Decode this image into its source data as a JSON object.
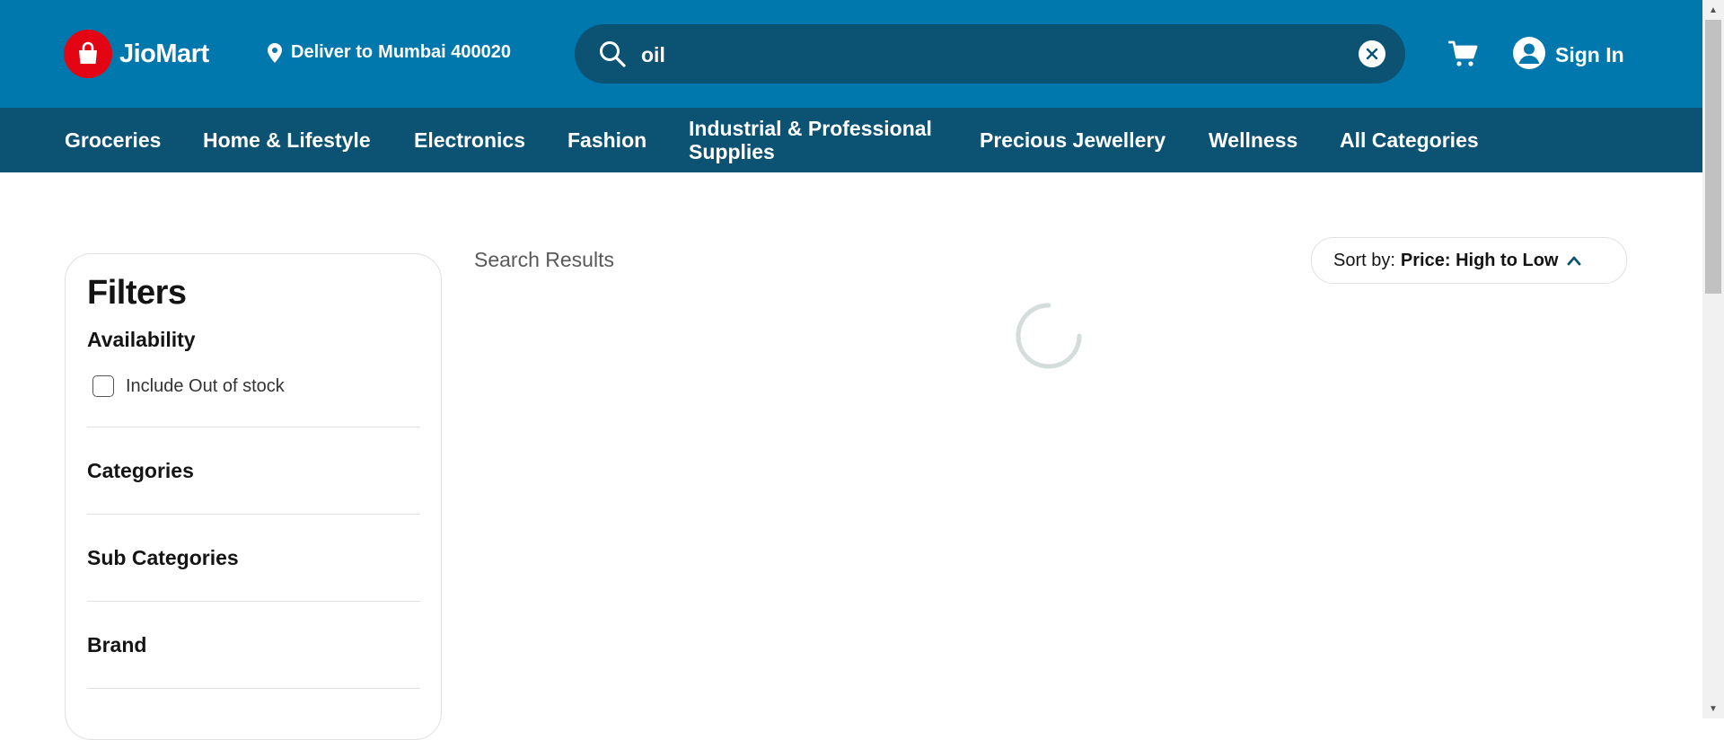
{
  "header": {
    "brand": "JioMart",
    "deliver_prefix": "Deliver to",
    "deliver_location": "Mumbai 400020",
    "search_value": "oil",
    "sign_in": "Sign In"
  },
  "nav": {
    "items": [
      {
        "label": "Groceries"
      },
      {
        "label": "Home & Lifestyle"
      },
      {
        "label": "Electronics"
      },
      {
        "label": "Fashion"
      },
      {
        "label": "Industrial & Professional Supplies"
      },
      {
        "label": "Precious Jewellery"
      },
      {
        "label": "Wellness"
      },
      {
        "label": "All Categories"
      }
    ]
  },
  "filters": {
    "title": "Filters",
    "availability": "Availability",
    "include_out_of_stock": "Include Out of stock",
    "categories": "Categories",
    "sub_categories": "Sub Categories",
    "brand": "Brand"
  },
  "results": {
    "title": "Search Results",
    "sort_prefix": "Sort by:",
    "sort_value": "Price: High to Low"
  },
  "colors": {
    "header_bg": "#0078ad",
    "nav_bg": "#0c5273",
    "brand_red": "#e30513"
  },
  "icons": {
    "logo": "shopping-bag-icon",
    "location": "location-pin-icon",
    "search": "search-icon",
    "clear": "close-circle-icon",
    "cart": "cart-icon",
    "profile": "user-avatar-icon",
    "sort": "chevron-up-icon",
    "loading": "spinner-icon"
  }
}
